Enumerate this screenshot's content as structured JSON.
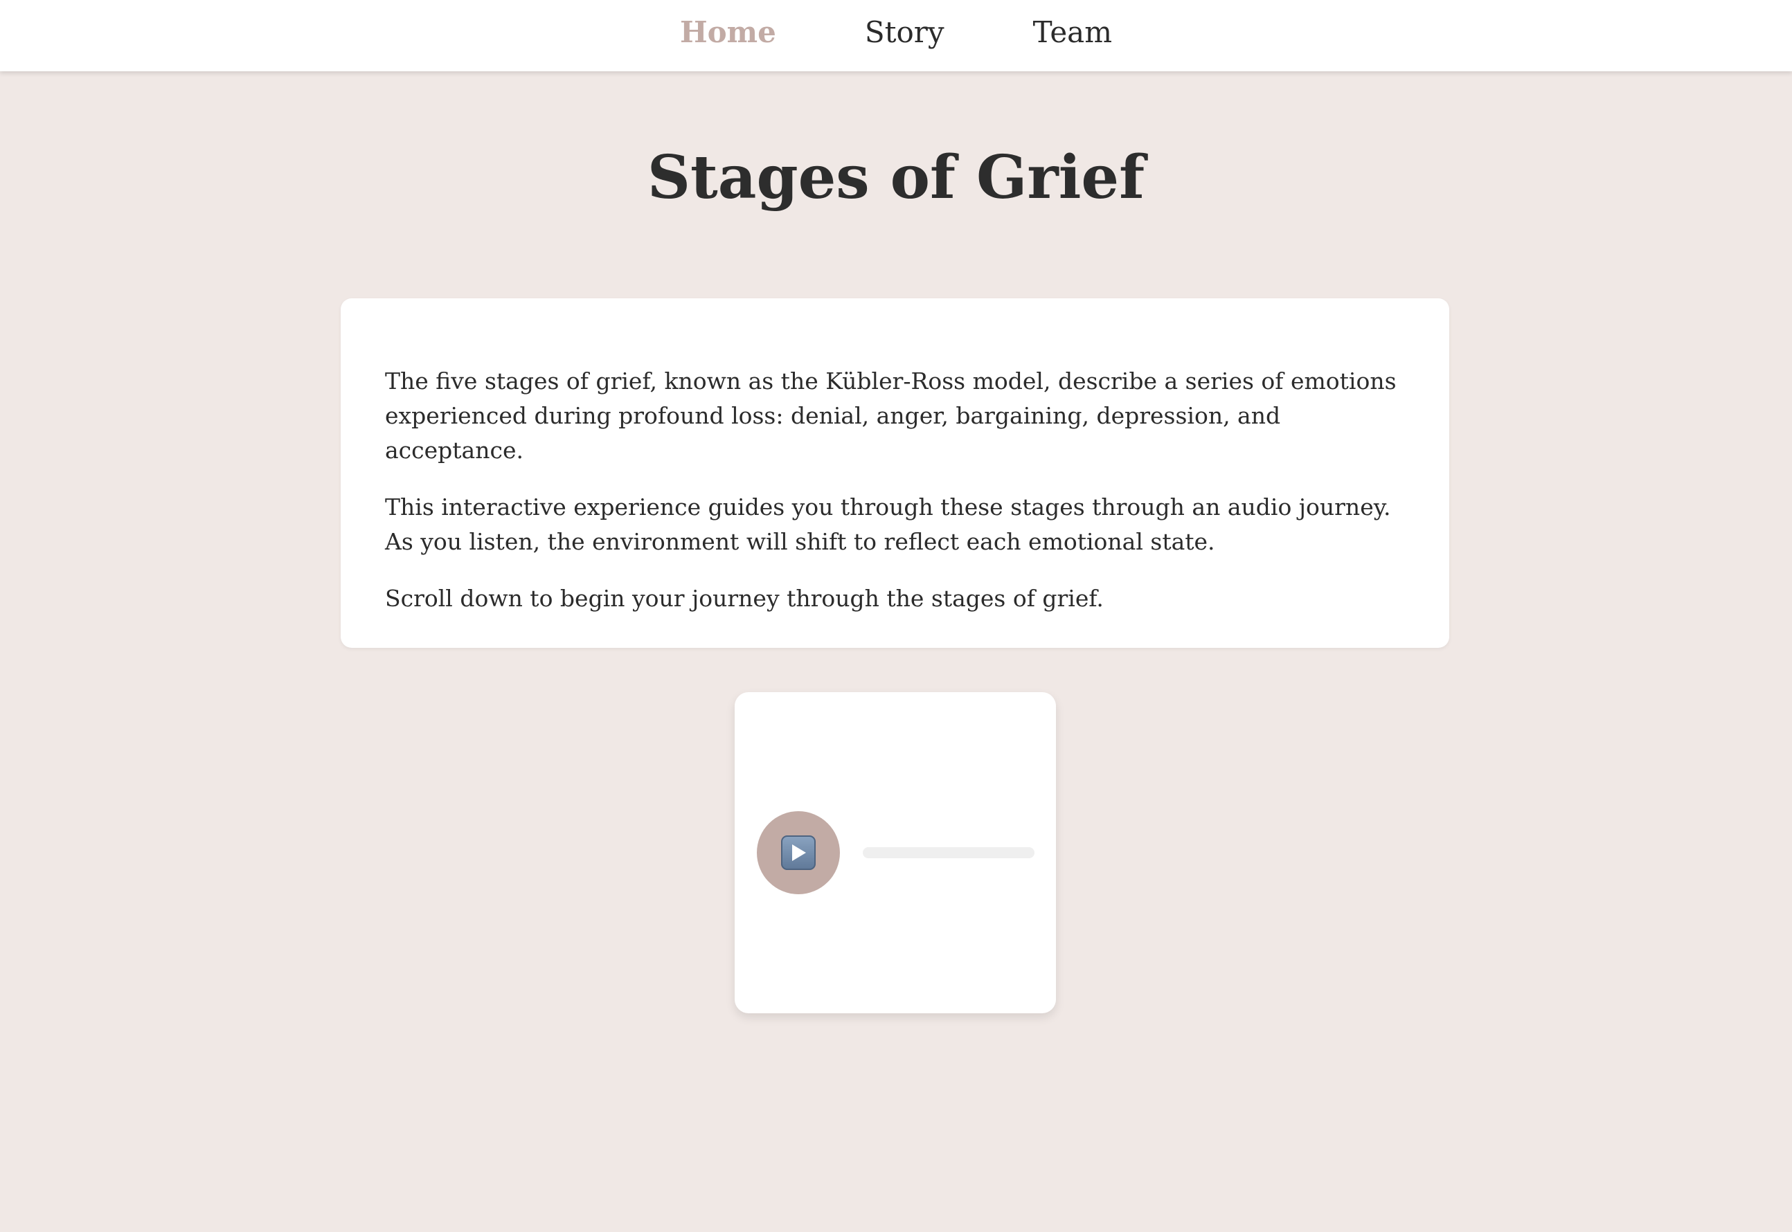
{
  "nav": {
    "items": [
      {
        "label": "Home",
        "active": true
      },
      {
        "label": "Story",
        "active": false
      },
      {
        "label": "Team",
        "active": false
      }
    ]
  },
  "header": {
    "title": "Stages of Grief"
  },
  "intro": {
    "paragraphs": [
      "The five stages of grief, known as the Kübler-Ross model, describe a series of emotions experienced during profound loss: denial, anger, bargaining, depression, and acceptance.",
      "This interactive experience guides you through these stages through an audio journey. As you listen, the environment will shift to reflect each emotional state.",
      "Scroll down to begin your journey through the stages of grief."
    ]
  },
  "player": {
    "play_icon": "play-icon",
    "progress": 0
  },
  "colors": {
    "background": "#f0e8e5",
    "accent": "#c2aba5",
    "card": "#ffffff",
    "text": "#2b2b2b"
  }
}
